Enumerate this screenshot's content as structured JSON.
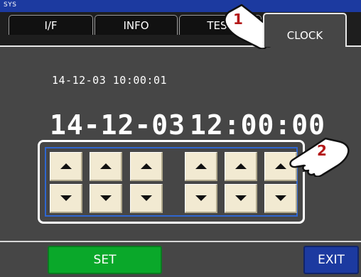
{
  "topbar": {
    "label": "SYS"
  },
  "tabs": [
    {
      "label": "I/F"
    },
    {
      "label": "INFO"
    },
    {
      "label": "TEST"
    },
    {
      "label": "CLOCK"
    }
  ],
  "clock": {
    "current": "14-12-03  10:00:01",
    "set_date": "14-12-03",
    "set_time": "12:00:00"
  },
  "footer": {
    "set_label": "SET",
    "exit_label": "EXIT"
  },
  "annotations": [
    {
      "number": "1"
    },
    {
      "number": "2"
    }
  ],
  "colors": {
    "accent_blue": "#1c3aa0",
    "set_green": "#0aa82a",
    "button_face": "#f2ead2",
    "annotation_red": "#b41818"
  },
  "icons": [
    "pointing-hand-icon",
    "arrow-up-icon",
    "arrow-down-icon"
  ]
}
